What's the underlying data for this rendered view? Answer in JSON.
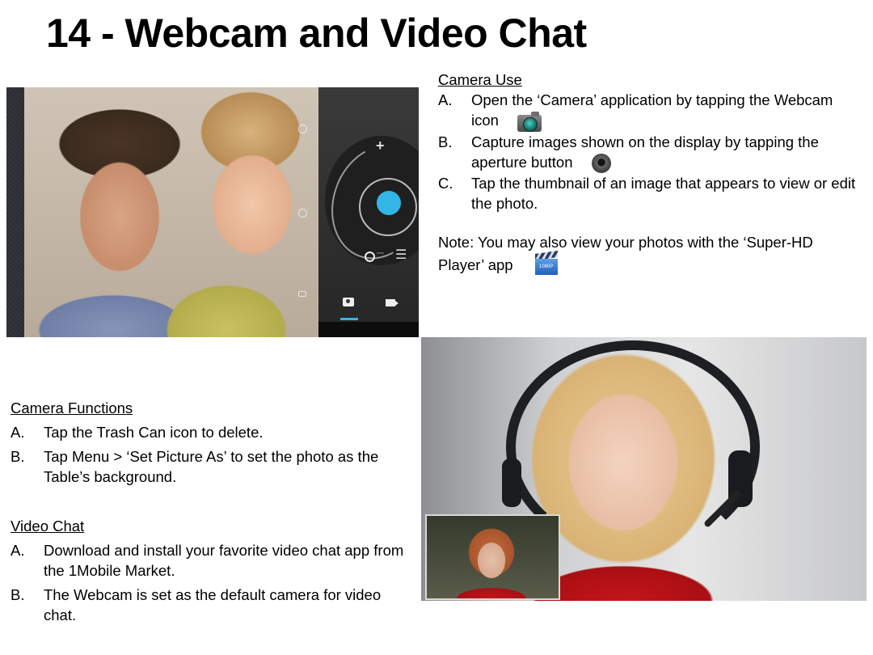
{
  "title": "14 - Webcam and Video Chat",
  "camera_use": {
    "heading": "Camera Use",
    "items": [
      {
        "letter": "A.",
        "text": "Open the ‘Camera’ application by tapping the Webcam icon",
        "icon": "camera-app-icon"
      },
      {
        "letter": "B.",
        "text": "Capture images shown on the display by tapping the aperture button",
        "icon": "aperture-button-icon"
      },
      {
        "letter": "C.",
        "text": "Tap the thumbnail of an image that appears to view or edit the photo."
      }
    ]
  },
  "note": {
    "text": "Note: You may also view your photos with the ‘Super-HD Player’ app",
    "icon": "super-hd-player-icon",
    "icon_label": "1080P"
  },
  "camera_functions": {
    "heading": "Camera Functions",
    "items": [
      {
        "letter": "A.",
        "text": "Tap the Trash Can icon to delete."
      },
      {
        "letter": "B.",
        "text": "Tap Menu > ‘Set Picture As’ to set the photo as the Table’s background."
      }
    ]
  },
  "video_chat": {
    "heading": "Video Chat",
    "items": [
      {
        "letter": "A.",
        "text": "Download and install your favorite video chat app from the 1Mobile Market."
      },
      {
        "letter": "B.",
        "text": "The Webcam is set as the default camera for video chat."
      }
    ]
  },
  "camera_screen": {
    "accent_color": "#33b5e5",
    "controls": [
      "zoom-in",
      "shutter",
      "zoom-out",
      "settings",
      "photo-mode",
      "video-mode"
    ],
    "active_mode": "photo"
  }
}
